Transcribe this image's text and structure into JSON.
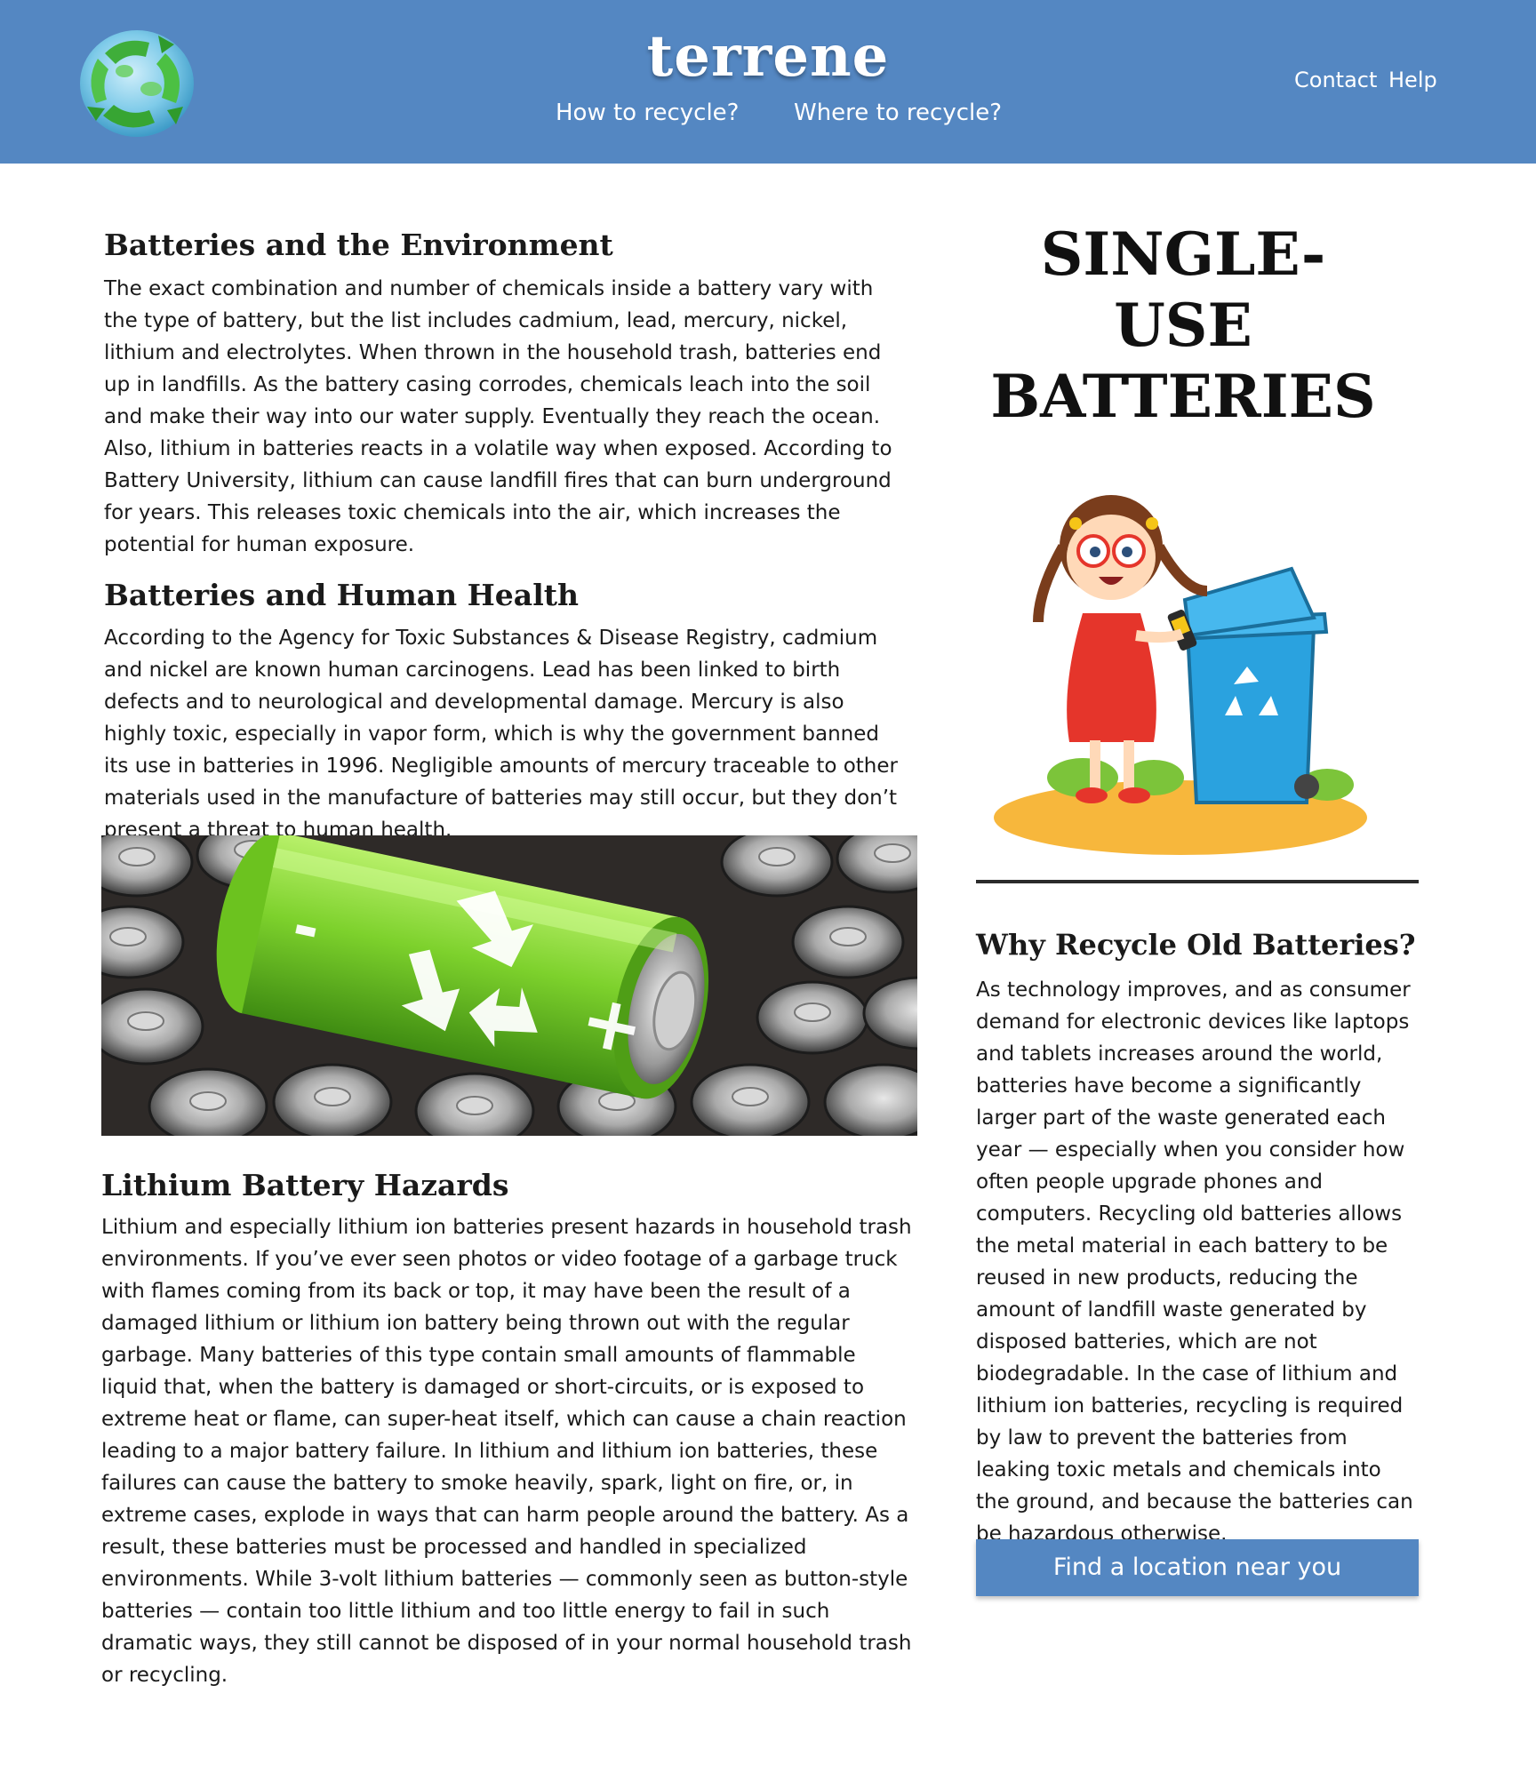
{
  "header": {
    "brand": "terrene",
    "nav": {
      "how": "How to recycle?",
      "where": "Where to recycle?"
    },
    "util": {
      "contact": "Contact",
      "help": "Help"
    },
    "logo_icon": "recycling-globe-icon"
  },
  "left": {
    "env": {
      "heading": "Batteries and the Environment",
      "text": "The exact combination and number of chemicals inside a battery vary with the type of battery, but the list includes cadmium, lead, mercury, nickel, lithium and electrolytes. When thrown in the household trash, batteries end up in landfills. As the battery casing corrodes, chemicals leach into the soil and make their way into our water supply. Eventually they reach the ocean. Also, lithium in batteries reacts in a volatile way when exposed. According to Battery University, lithium can cause landfill fires that can burn underground for years. This releases toxic chemicals into the air, which increases the potential for human exposure."
    },
    "health": {
      "heading": "Batteries and Human Health",
      "text": "According to the Agency for Toxic Substances & Disease Registry, cadmium and nickel are known human carcinogens. Lead has been linked to birth defects and to neurological and developmental damage. Mercury is also highly toxic, especially in vapor form, which is why the government banned its use in batteries in 1996. Negligible amounts of mercury traceable to other materials used in the manufacture of batteries may still occur, but they don’t present a threat to human health."
    },
    "lithium": {
      "heading": "Lithium Battery Hazards",
      "text": "Lithium and especially lithium ion batteries present hazards in household trash environments. If you’ve ever seen photos or video footage of a garbage truck with flames coming from its back or top, it may have been the result of a damaged lithium or lithium ion battery being thrown out with the regular garbage. Many batteries of this type contain small amounts of flammable liquid that, when the battery is damaged or short-circuits, or is exposed to extreme heat or flame, can super-heat itself, which can cause a chain reaction leading to a major battery failure. In lithium and lithium ion batteries, these failures can cause the battery to smoke heavily, spark, light on fire, or, in extreme cases, explode in ways that can harm people around the battery. As a result, these batteries must be processed and handled in specialized environments. While 3-volt lithium batteries — commonly seen as button-style batteries — contain too little lithium and too little energy to fail in such dramatic ways, they still cannot be disposed of in your normal household trash or recycling."
    },
    "battery_image_icon": "green-recycle-battery-image",
    "battery_plus": "+",
    "battery_minus": "-"
  },
  "right": {
    "title_line1": "SINGLE-USE",
    "title_line2": "BATTERIES",
    "kid_image_icon": "girl-recycling-battery-image",
    "why": {
      "heading": "Why Recycle Old Batteries?",
      "text": "As technology improves, and as consumer demand for electronic devices like laptops and tablets increases around the world, batteries have become a significantly larger part of the waste generated each year — especially when you consider how often people upgrade phones and computers. Recycling old batteries allows the metal material in each battery to be reused in new products, reducing the amount of landfill waste generated by disposed batteries, which are not biodegradable. In the case of lithium and lithium ion batteries, recycling is required by law to prevent the batteries from leaking toxic metals and chemicals into the ground, and because the batteries can be hazardous otherwise."
    },
    "button": "Find a location near you"
  },
  "colors": {
    "header": "#5487c2",
    "button": "#5487c2",
    "battery_green": "#7dd12c"
  }
}
